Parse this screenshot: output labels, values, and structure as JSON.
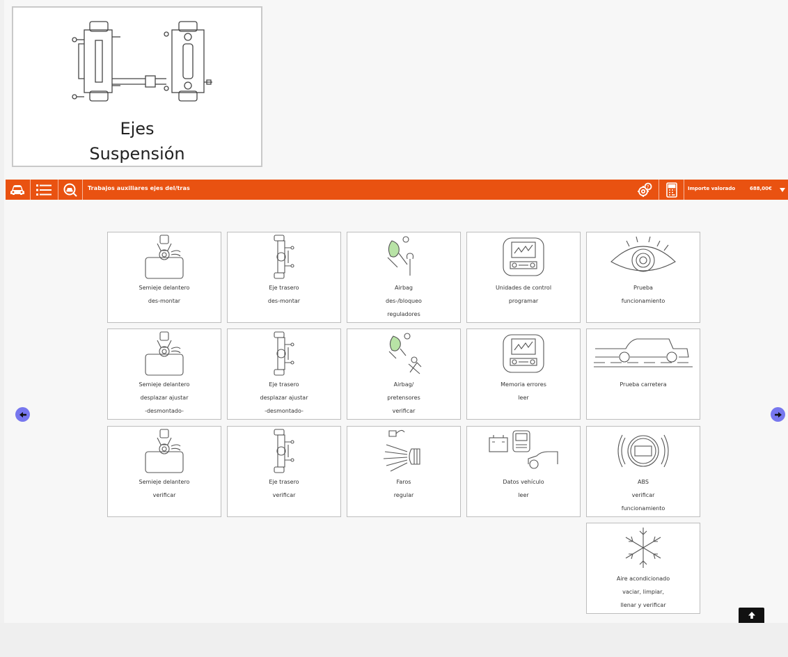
{
  "header": {
    "title_line1": "Ejes",
    "title_line2": "Suspensión",
    "icon": "axle-chassis-icon"
  },
  "toolbar": {
    "title": "Trabajos auxiliares ejes del/tras",
    "valuation_label": "Importe valorado",
    "valuation_amount": "688,00€",
    "accent_color": "#e95211",
    "icons": [
      "car-icon",
      "list-icon",
      "search-car-icon",
      "settings-help-icon",
      "calculator-icon",
      "chevron-down-icon"
    ]
  },
  "cards": [
    {
      "lines": [
        "Semieje delantero",
        "des-montar"
      ],
      "icon": "front-axle-icon"
    },
    {
      "lines": [
        "Eje trasero",
        "des-montar"
      ],
      "icon": "rear-axle-icon"
    },
    {
      "lines": [
        "Airbag",
        "des-/bloqueo",
        "reguladores"
      ],
      "icon": "airbag-wrench-icon"
    },
    {
      "lines": [
        "Unidades de control",
        "programar"
      ],
      "icon": "control-unit-icon"
    },
    {
      "lines": [
        "Prueba",
        "funcionamiento"
      ],
      "icon": "eye-icon"
    },
    {
      "lines": [
        "Semieje delantero",
        "desplazar ajustar",
        "-desmontado-"
      ],
      "icon": "front-axle-icon"
    },
    {
      "lines": [
        "Eje trasero",
        "desplazar ajustar",
        "-desmontado-"
      ],
      "icon": "rear-axle-icon"
    },
    {
      "lines": [
        "Airbag/",
        "pretensores",
        "verificar"
      ],
      "icon": "airbag-seatbelt-icon"
    },
    {
      "lines": [
        "Memoria errores",
        "leer"
      ],
      "icon": "control-unit-icon"
    },
    {
      "lines": [
        "Prueba carretera"
      ],
      "icon": "road-test-car-icon"
    },
    {
      "lines": [
        "Semieje delantero",
        "verificar"
      ],
      "icon": "front-axle-icon"
    },
    {
      "lines": [
        "Eje trasero",
        "verificar"
      ],
      "icon": "rear-axle-icon"
    },
    {
      "lines": [
        "Faros",
        "regular"
      ],
      "icon": "headlight-icon"
    },
    {
      "lines": [
        "Datos vehículo",
        "leer"
      ],
      "icon": "vehicle-data-icon"
    },
    {
      "lines": [
        "ABS",
        "verificar",
        "funcionamiento"
      ],
      "icon": "abs-icon"
    },
    {
      "lines": [
        "Aire acondicionado",
        "vaciar, limpiar,",
        "llenar y verificar"
      ],
      "icon": "snowflake-icon"
    }
  ],
  "nav": {
    "prev_icon": "arrow-left-icon",
    "next_icon": "arrow-right-icon",
    "scroll_top_icon": "arrow-up-icon"
  }
}
